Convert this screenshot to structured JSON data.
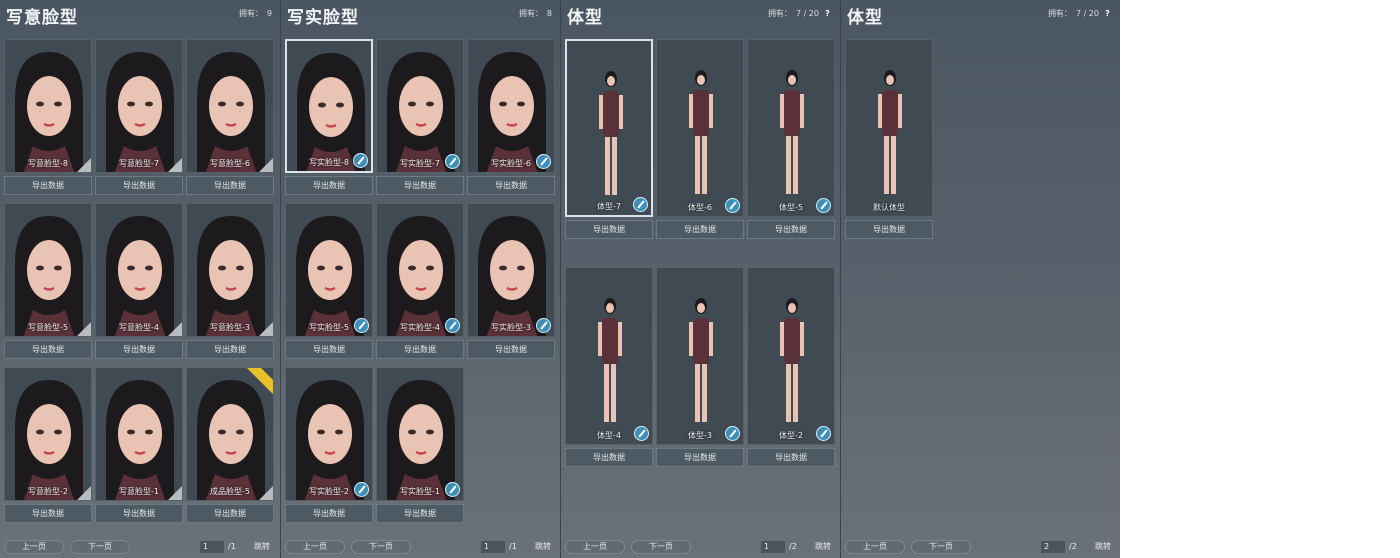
{
  "panels": [
    {
      "title": "写意脸型",
      "owned_label": "拥有：",
      "owned_value": "9",
      "show_help": false,
      "cards": [
        {
          "name": "写意脸型-8",
          "brush": false,
          "tag": false,
          "selected": false
        },
        {
          "name": "写意脸型-7",
          "brush": false,
          "tag": false,
          "selected": false
        },
        {
          "name": "写意脸型-6",
          "brush": false,
          "tag": false,
          "selected": false
        },
        {
          "name": "写意脸型-5",
          "brush": false,
          "tag": false,
          "selected": false
        },
        {
          "name": "写意脸型-4",
          "brush": false,
          "tag": false,
          "selected": false
        },
        {
          "name": "写意脸型-3",
          "brush": false,
          "tag": false,
          "selected": false
        },
        {
          "name": "写意脸型-2",
          "brush": false,
          "tag": false,
          "selected": false
        },
        {
          "name": "写意脸型-1",
          "brush": false,
          "tag": false,
          "selected": false
        },
        {
          "name": "成品脸型-5",
          "brush": false,
          "tag": true,
          "selected": false
        }
      ],
      "export_label": "导出数据",
      "pager": {
        "prev": "上一页",
        "next": "下一页",
        "page": "1",
        "total": "/1",
        "jump": "跳转"
      }
    },
    {
      "title": "写实脸型",
      "owned_label": "拥有：",
      "owned_value": "8",
      "show_help": false,
      "cards": [
        {
          "name": "写实脸型-8",
          "brush": true,
          "tag": false,
          "selected": true
        },
        {
          "name": "写实脸型-7",
          "brush": true,
          "tag": false,
          "selected": false
        },
        {
          "name": "写实脸型-6",
          "brush": true,
          "tag": false,
          "selected": false
        },
        {
          "name": "写实脸型-5",
          "brush": true,
          "tag": false,
          "selected": false
        },
        {
          "name": "写实脸型-4",
          "brush": true,
          "tag": false,
          "selected": false
        },
        {
          "name": "写实脸型-3",
          "brush": true,
          "tag": false,
          "selected": false
        },
        {
          "name": "写实脸型-2",
          "brush": true,
          "tag": false,
          "selected": false
        },
        {
          "name": "写实脸型-1",
          "brush": true,
          "tag": false,
          "selected": false
        }
      ],
      "export_label": "导出数据",
      "pager": {
        "prev": "上一页",
        "next": "下一页",
        "page": "1",
        "total": "/1",
        "jump": "跳转"
      }
    },
    {
      "title": "体型",
      "owned_label": "拥有：",
      "owned_value": "7 / 20",
      "show_help": true,
      "cards": [
        {
          "name": "体型-7",
          "brush": true,
          "tag": false,
          "selected": true
        },
        {
          "name": "体型-6",
          "brush": true,
          "tag": false,
          "selected": false
        },
        {
          "name": "体型-5",
          "brush": true,
          "tag": false,
          "selected": false
        },
        {
          "name": "体型-4",
          "brush": true,
          "tag": false,
          "selected": false
        },
        {
          "name": "体型-3",
          "brush": true,
          "tag": false,
          "selected": false
        },
        {
          "name": "体型-2",
          "brush": true,
          "tag": false,
          "selected": false
        }
      ],
      "export_label": "导出数据",
      "pager": {
        "prev": "上一页",
        "next": "下一页",
        "page": "1",
        "total": "/2",
        "jump": "跳转"
      }
    },
    {
      "title": "体型",
      "owned_label": "拥有：",
      "owned_value": "7 / 20",
      "show_help": true,
      "cards": [
        {
          "name": "默认体型",
          "brush": false,
          "tag": false,
          "selected": false
        }
      ],
      "export_label": "导出数据",
      "pager": {
        "prev": "上一页",
        "next": "下一页",
        "page": "2",
        "total": "/2",
        "jump": "跳转"
      }
    }
  ],
  "help_symbol": "?",
  "colors": {
    "brush": "#3d8fb8",
    "tag": "#e8c12a",
    "hair": "#1c1a1c",
    "skin": "#e9c3b4",
    "dress": "#5a3039"
  }
}
